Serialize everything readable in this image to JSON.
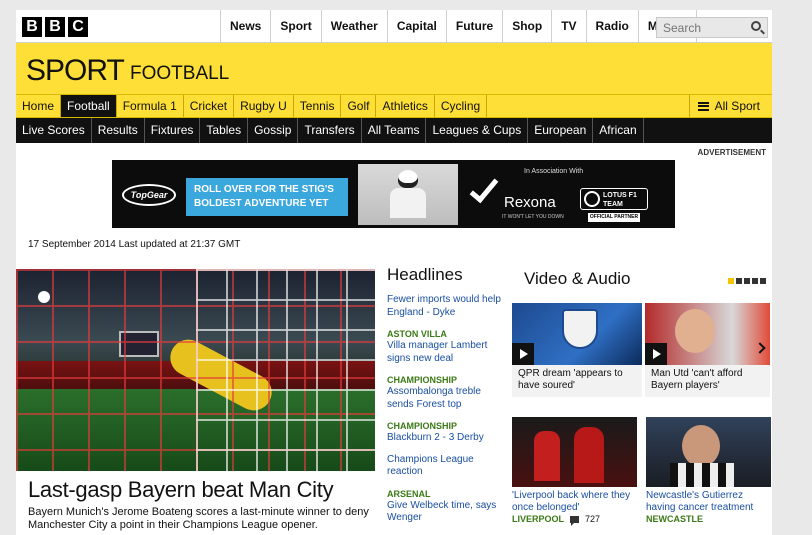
{
  "topbar": {
    "logo_letters": [
      "B",
      "B",
      "C"
    ],
    "nav": [
      "News",
      "Sport",
      "Weather",
      "Capital",
      "Future",
      "Shop",
      "TV",
      "Radio",
      "More..."
    ],
    "search_placeholder": "Search"
  },
  "header": {
    "brand": "SPORT",
    "section": "FOOTBALL"
  },
  "sport_nav": {
    "items": [
      "Home",
      "Football",
      "Formula 1",
      "Cricket",
      "Rugby U",
      "Tennis",
      "Golf",
      "Athletics",
      "Cycling"
    ],
    "active": "Football",
    "all_sport": "All Sport"
  },
  "football_nav": {
    "items": [
      "Live Scores",
      "Results",
      "Fixtures",
      "Tables",
      "Gossip",
      "Transfers",
      "All Teams",
      "Leagues & Cups",
      "European",
      "African"
    ]
  },
  "advert": {
    "label": "ADVERTISEMENT",
    "topgear": "TopGear",
    "line1": "ROLL OVER FOR THE STIG'S",
    "line2": "BOLDEST ADVENTURE YET",
    "assoc": "In Association With",
    "rexona": "Rexona",
    "rexona_tag": "IT WON'T LET YOU DOWN",
    "lotus": "LOTUS F1 TEAM",
    "lotus_partner": "OFFICIAL PARTNER"
  },
  "updated": "17 September 2014 Last updated at 21:37 GMT",
  "hero": {
    "headline": "Last-gasp Bayern beat Man City",
    "summary": "Bayern Munich's Jerome Boateng scores a last-minute winner to deny Manchester City a point in their Champions League opener."
  },
  "headlines": {
    "title": "Headlines",
    "items": [
      {
        "category": "",
        "text": "Fewer imports would help England - Dyke"
      },
      {
        "category": "ASTON VILLA",
        "text": "Villa manager Lambert signs new deal"
      },
      {
        "category": "CHAMPIONSHIP",
        "text": "Assombalonga treble sends Forest top"
      },
      {
        "category": "CHAMPIONSHIP",
        "text": "Blackburn 2 - 3 Derby"
      },
      {
        "category": "",
        "text": "Champions League reaction"
      },
      {
        "category": "ARSENAL",
        "text": "Give Welbeck time, says Wenger"
      }
    ]
  },
  "video": {
    "title": "Video & Audio",
    "items": [
      {
        "caption": "QPR dream 'appears to have soured'"
      },
      {
        "caption": "Man Utd 'can't afford Bayern players'"
      }
    ]
  },
  "stories": [
    {
      "text": "'Liverpool back where they once belonged'",
      "category": "LIVERPOOL",
      "comments": "727"
    },
    {
      "text": "Newcastle's Gutierrez having cancer treatment",
      "category": "NEWCASTLE",
      "comments": ""
    }
  ],
  "colors": {
    "bbc_yellow": "#fedf37",
    "link_blue": "#1a4fa0",
    "category_green": "#3b7a16"
  }
}
